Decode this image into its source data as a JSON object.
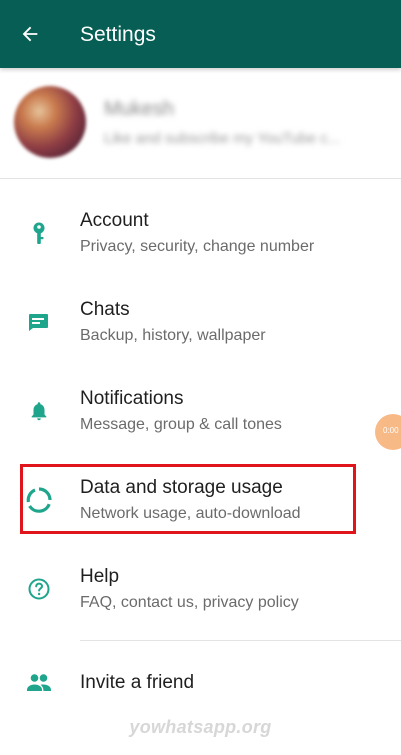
{
  "appbar": {
    "title": "Settings",
    "background": "#075e54"
  },
  "profile": {
    "name": "Mukesh",
    "status": "Like and subscribe my YouTube c..."
  },
  "menu": [
    {
      "title": "Account",
      "subtitle": "Privacy, security, change number",
      "icon": "key-icon"
    },
    {
      "title": "Chats",
      "subtitle": "Backup, history, wallpaper",
      "icon": "chat-icon"
    },
    {
      "title": "Notifications",
      "subtitle": "Message, group & call tones",
      "icon": "bell-icon"
    },
    {
      "title": "Data and storage usage",
      "subtitle": "Network usage, auto-download",
      "icon": "data-usage-icon"
    },
    {
      "title": "Help",
      "subtitle": "FAQ, contact us, privacy policy",
      "icon": "help-icon"
    },
    {
      "title": "Invite a friend",
      "subtitle": "",
      "icon": "people-icon"
    }
  ],
  "floating_badge": {
    "text": "0:00"
  },
  "watermark": "yowhatsapp.org",
  "colors": {
    "accent": "#075e54",
    "icon": "#1ea58c",
    "highlight": "#e0141b"
  }
}
